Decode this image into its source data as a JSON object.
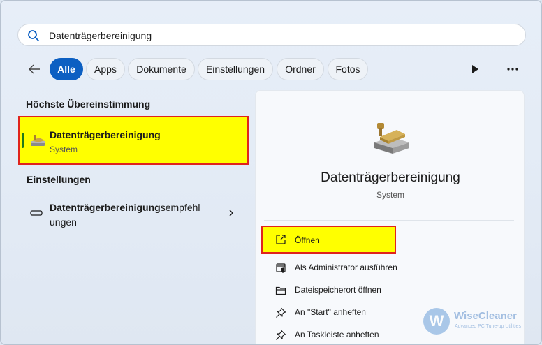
{
  "search": {
    "value": "Datenträgerbereinigung",
    "icon": "search-icon"
  },
  "filters": {
    "chips": [
      {
        "label": "Alle",
        "active": true
      },
      {
        "label": "Apps",
        "active": false
      },
      {
        "label": "Dokumente",
        "active": false
      },
      {
        "label": "Einstellungen",
        "active": false
      },
      {
        "label": "Ordner",
        "active": false
      },
      {
        "label": "Fotos",
        "active": false
      }
    ]
  },
  "left": {
    "best_match_heading": "Höchste Übereinstimmung",
    "best_match": {
      "title": "Datenträgerbereinigung",
      "subtitle": "System",
      "icon": "disk-cleanup-icon"
    },
    "settings_heading": "Einstellungen",
    "setting_item": {
      "bold": "Datenträgerbereinigung",
      "rest_line1": "sempfehl",
      "line2": "ungen",
      "icon": "drive-icon"
    }
  },
  "detail": {
    "title": "Datenträgerbereinigung",
    "subtitle": "System",
    "actions": [
      {
        "label": "Öffnen",
        "icon": "open-external-icon",
        "highlighted": true
      },
      {
        "label": "Als Administrator ausführen",
        "icon": "shield-admin-icon"
      },
      {
        "label": "Dateispeicherort öffnen",
        "icon": "folder-icon"
      },
      {
        "label": "An \"Start\" anheften",
        "icon": "pin-icon"
      },
      {
        "label": "An Taskleiste anheften",
        "icon": "pin-icon"
      }
    ]
  },
  "watermark": {
    "letter": "W",
    "name": "WiseCleaner",
    "tagline": "Advanced PC Tune-up Utilities"
  },
  "colors": {
    "accent": "#0c5fc2",
    "highlight": "#ffff00",
    "highlight_border": "#e0241c"
  }
}
